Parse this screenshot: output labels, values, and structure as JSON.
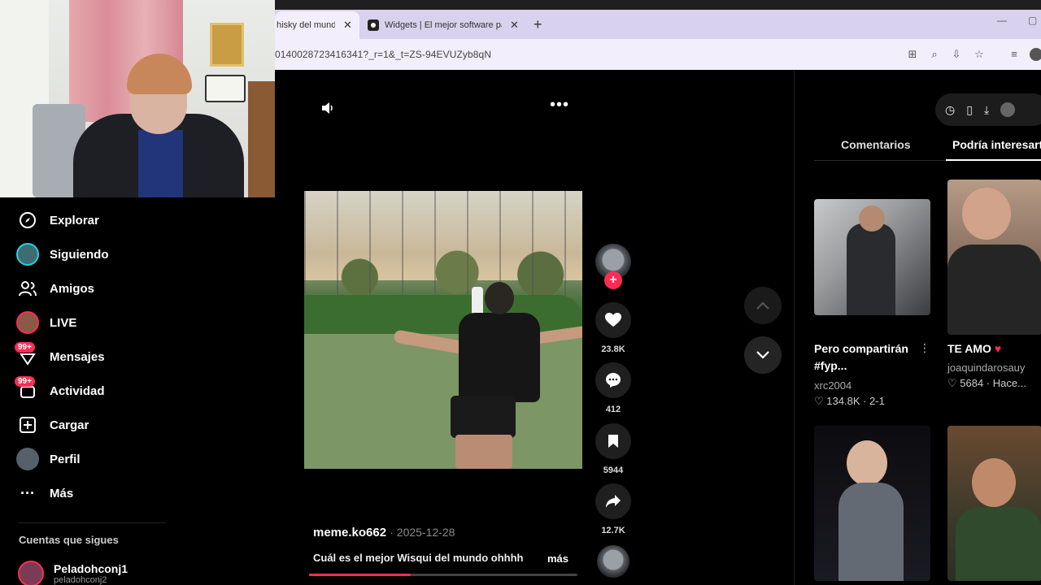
{
  "browser": {
    "tabs": [
      {
        "label": "hisky del mund",
        "active": true
      },
      {
        "label": "Widgets | El mejor software par",
        "active": false
      }
    ],
    "new_tab": "+",
    "url": "0140028723416341?_r=1&_t=ZS-94EVUZyb8qN",
    "window_controls": {
      "minimize": "—",
      "maximize": "▢"
    }
  },
  "sidebar": {
    "items": [
      {
        "label": "Explorar",
        "icon": "compass-icon"
      },
      {
        "label": "Siguiendo",
        "icon": "following-avatar-icon"
      },
      {
        "label": "Amigos",
        "icon": "friends-icon"
      },
      {
        "label": "LIVE",
        "icon": "live-avatar-icon"
      },
      {
        "label": "Mensajes",
        "icon": "messages-icon",
        "badge": "99+"
      },
      {
        "label": "Actividad",
        "icon": "activity-icon",
        "badge": "99+"
      },
      {
        "label": "Cargar",
        "icon": "upload-icon"
      },
      {
        "label": "Perfil",
        "icon": "profile-avatar-icon"
      },
      {
        "label": "Más",
        "icon": "more-dots-icon"
      }
    ],
    "following_title": "Cuentas que sigues",
    "following": [
      {
        "name": "Peladohconj1",
        "handle": "peladohconj2"
      }
    ]
  },
  "video": {
    "actions": {
      "likes": "23.8K",
      "comments": "412",
      "saves": "5944",
      "shares": "12.7K"
    },
    "author": "meme.ko662",
    "date": "· 2025-12-28",
    "caption": "Cuál es el mejor Wisqui del mundo ohhhh",
    "more_label": "más",
    "progress": 0.38
  },
  "right_panel": {
    "tabs": [
      "Comentarios",
      "Podría interesarte"
    ],
    "active_tab": "Podría interesarte",
    "cards": [
      {
        "title_line1": "Pero compartirán",
        "title_line2": "#fyp...",
        "user": "xrc2004",
        "stats": "134.8K · 2-1"
      },
      {
        "title_line1": "TE AMO",
        "title_line2": "",
        "user": "joaquindarosauy",
        "stats": "5684 · Hace..."
      }
    ]
  },
  "colors": {
    "accent": "#fe2c55",
    "background": "#000000",
    "chrome": "#d8d2ee"
  }
}
